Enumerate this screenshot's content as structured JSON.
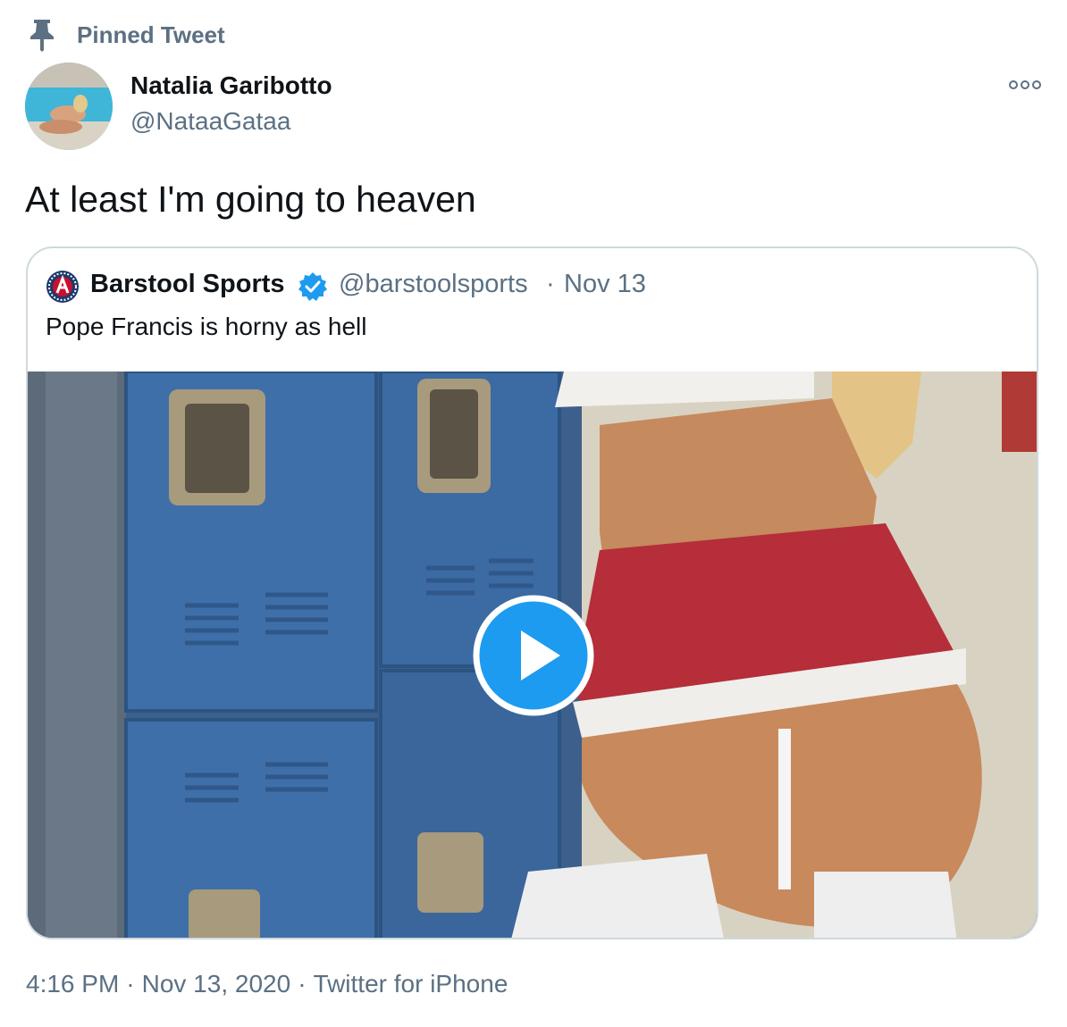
{
  "pinned": {
    "label": "Pinned Tweet",
    "icon": "pin-icon"
  },
  "tweet": {
    "author_name": "Natalia Garibotto",
    "author_handle": "@NataaGataa",
    "text": "At least I'm going to heaven",
    "more_icon": "more-options-icon"
  },
  "quote": {
    "author_name": "Barstool Sports",
    "verified": true,
    "author_handle": "@barstoolsports",
    "separator": "·",
    "date": "Nov 13",
    "text": "Pope Francis is horny as hell",
    "media": {
      "type": "video",
      "play_icon": "play-icon",
      "accent": "#1d9bf0"
    }
  },
  "meta": {
    "time": "4:16 PM",
    "sep1": "·",
    "date": "Nov 13, 2020",
    "sep2": "·",
    "source": "Twitter for iPhone"
  },
  "colors": {
    "text_primary": "#0f1419",
    "text_secondary": "#5b7083",
    "border": "#cfd9de",
    "verified": "#1d9bf0"
  }
}
